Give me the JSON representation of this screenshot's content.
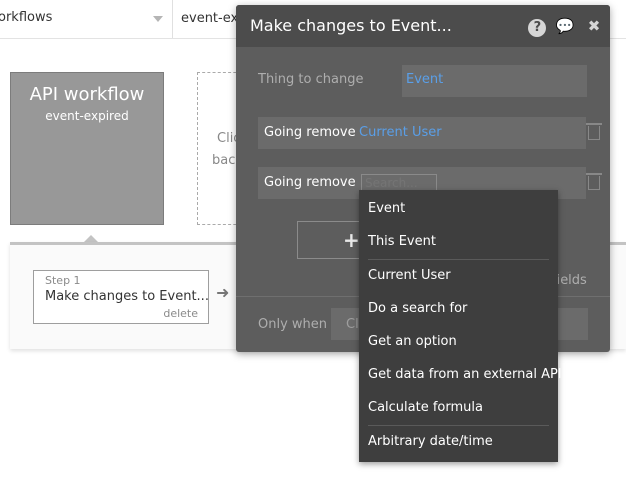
{
  "topbar": {
    "left_label": "orkflows",
    "right_label": "event-ex"
  },
  "canvas": {
    "api_title": "API workflow",
    "api_subtitle": "event-expired",
    "dashed_text_1": "Clic",
    "dashed_text_2": "back"
  },
  "step": {
    "label": "Step 1",
    "name": "Make changes to Event...",
    "delete_label": "delete"
  },
  "panel": {
    "title": "Make changes to Event...",
    "thing_label": "Thing to change",
    "thing_value": "Event",
    "row1_label": "Going remove",
    "row1_value": "Current User",
    "row2_label": "Going remove",
    "search_placeholder": "Search...",
    "add_symbol": "+",
    "fields_text": "fields",
    "only_when_label": "Only when",
    "only_when_value": "Cli"
  },
  "dropdown": {
    "items": [
      "Event",
      "This Event",
      "Current User",
      "Do a search for",
      "Get an option",
      "Get data from an external API",
      "Calculate formula",
      "Arbitrary date/time"
    ]
  }
}
